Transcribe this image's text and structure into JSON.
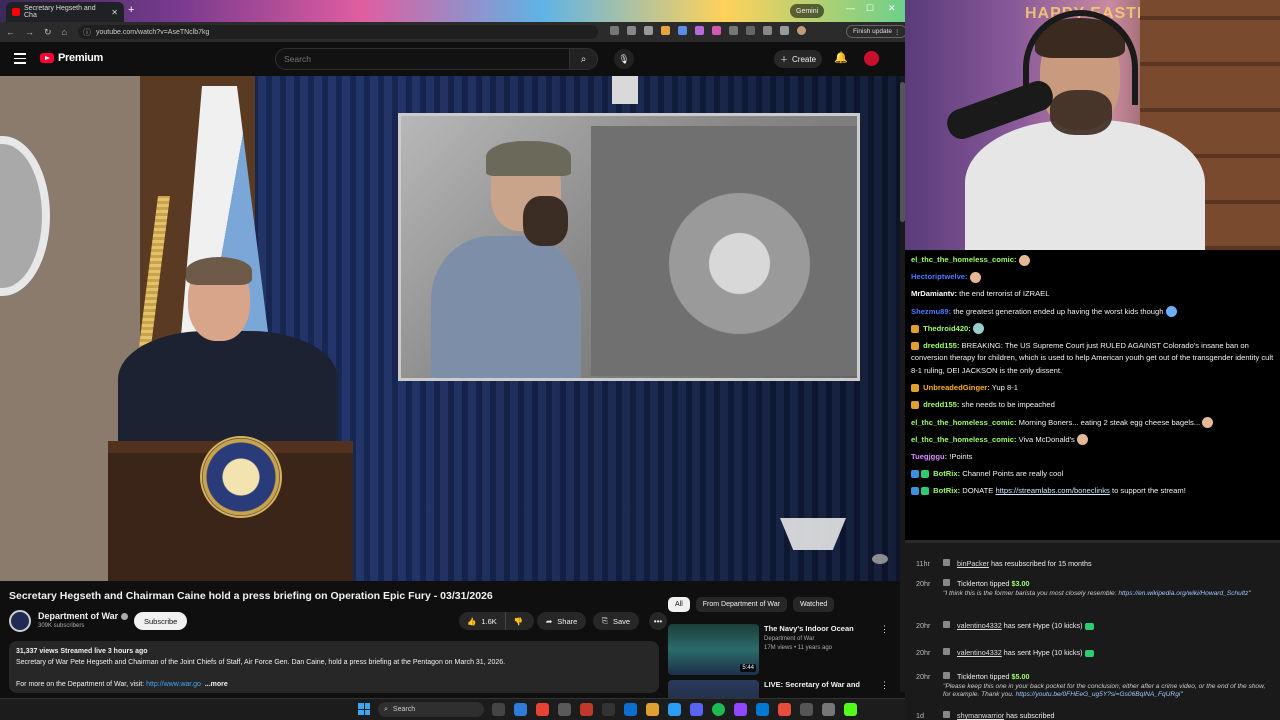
{
  "browser": {
    "tab_title": "Secretary Hegseth and Cha",
    "new_tab": "+",
    "gemini": "Gemini",
    "url": "youtube.com/watch?v=AseTNclb7kg",
    "finish_update": "Finish update",
    "window_min": "—",
    "window_max": "☐",
    "window_close": "✕"
  },
  "youtube": {
    "logo_text": "Premium",
    "search_placeholder": "Search",
    "create_label": "Create",
    "video_title": "Secretary Hegseth and Chairman Caine hold a press briefing on Operation Epic Fury - 03/31/2026",
    "channel_name": "Department of War",
    "channel_subs": "309K subscribers",
    "subscribe_label": "Subscribe",
    "like_count": "1.6K",
    "share_label": "Share",
    "save_label": "Save",
    "more_label": "•••",
    "description": {
      "meta": "31,337 views  Streamed live 3 hours ago",
      "text": "Secretary of War Pete Hegseth and Chairman of the Joint Chiefs of Staff, Air Force Gen. Dan Caine, hold a press briefing at the Pentagon on March 31, 2026.",
      "more_text": "For more on the Department of War, visit: ",
      "link": "http://www.war.go",
      "more": "...more"
    },
    "chips": [
      "All",
      "From Department of War",
      "Watched"
    ],
    "recommendations": [
      {
        "title": "The Navy's Indoor Ocean",
        "channel": "Department of War",
        "meta": "17M views • 11 years ago",
        "duration": "5:44"
      },
      {
        "title": "LIVE: Secretary of War and",
        "channel": "",
        "meta": "",
        "duration": ""
      }
    ]
  },
  "taskbar": {
    "search": "Search"
  },
  "stream": {
    "banner": "HAPPY EASTER",
    "chat": [
      {
        "user": "el_thc_the_homeless_comic:",
        "color": "#9dff6a",
        "text": "",
        "badge": ""
      },
      {
        "user": "Hectoriptwelve:",
        "color": "#4a7bff",
        "text": "",
        "badge": ""
      },
      {
        "user": "MrDamiantv:",
        "color": "#ffffff",
        "text": "the end terrorist of IZRAEL",
        "badge": ""
      },
      {
        "user": "Shezmu89:",
        "color": "#4a7bff",
        "text": "the greatest generation ended up having the worst kids though",
        "badge": ""
      },
      {
        "user": "Thedroid420:",
        "color": "#9dff6a",
        "text": "",
        "badge": "#e0a030"
      },
      {
        "user": "dredd155:",
        "color": "#9dff6a",
        "text": "BREAKING: The US Supreme Court just RULED AGAINST Colorado's insane ban on conversion therapy for children, which is used to help American youth get out of the transgender identity cult 8-1 ruling, DEI JACKSON is the only dissent.",
        "badge": "#e0a030"
      },
      {
        "user": "UnbreadedGinger:",
        "color": "#ffb020",
        "text": "Yup 8-1",
        "badge": "#e0a030"
      },
      {
        "user": "dredd155:",
        "color": "#9dff6a",
        "text": "she needs to be impeached",
        "badge": "#e0a030"
      },
      {
        "user": "el_thc_the_homeless_comic:",
        "color": "#9dff6a",
        "text": "Morning Boners... eating 2 steak egg cheese bagels...",
        "badge": ""
      },
      {
        "user": "el_thc_the_homeless_comic:",
        "color": "#9dff6a",
        "text": "Viva McDonald's",
        "badge": ""
      },
      {
        "user": "Tuegjggu:",
        "color": "#d98aff",
        "text": "!Points",
        "badge": ""
      },
      {
        "user": "BotRix:",
        "color": "#9dff6a",
        "text": "Channel Points are really cool",
        "badge": "#3a8fe0"
      },
      {
        "user": "BotRix:",
        "color": "#9dff6a",
        "text": "DONATE ",
        "link": "https://streamlabs.com/boneclinks",
        "after": " to support the stream!",
        "badge": "#3a8fe0"
      }
    ],
    "events": [
      {
        "time": "11hr",
        "name": "binPacker",
        "text": " has resubscribed for 15 months",
        "note": ""
      },
      {
        "time": "20hr",
        "name": "Ticklerton",
        "text": " tipped ",
        "amount": "$3.00",
        "note": "\"I think this is the former barista you most closely resemble: ",
        "note_link": "https://en.wikipedia.org/wiki/Howard_Schultz",
        "note_end": "\""
      },
      {
        "time": "20hr",
        "name": "valentino4332",
        "text": " has sent ",
        "hype": "Hype (10 kicks)",
        "note": ""
      },
      {
        "time": "20hr",
        "name": "valentino4332",
        "text": " has sent ",
        "hype": "Hype (10 kicks)",
        "note": ""
      },
      {
        "time": "20hr",
        "name": "Ticklerton",
        "text": " tipped ",
        "amount": "$5.00",
        "note": "\"Please keep this one in your back pocket for the conclusion; either after a crime video, or the end of the show, for example. Thank you. ",
        "note_link": "https://youtu.be/0FHEeG_ug5Y?si=Gs06BqINA_FqURgi",
        "note_end": "\""
      },
      {
        "time": "1d",
        "name": "shymanwarrior",
        "text": " has subscribed",
        "note": ""
      }
    ]
  },
  "colors": {
    "accent_red": "#ff0033",
    "link_blue": "#3ea6ff",
    "chat_bg": "#000000"
  }
}
